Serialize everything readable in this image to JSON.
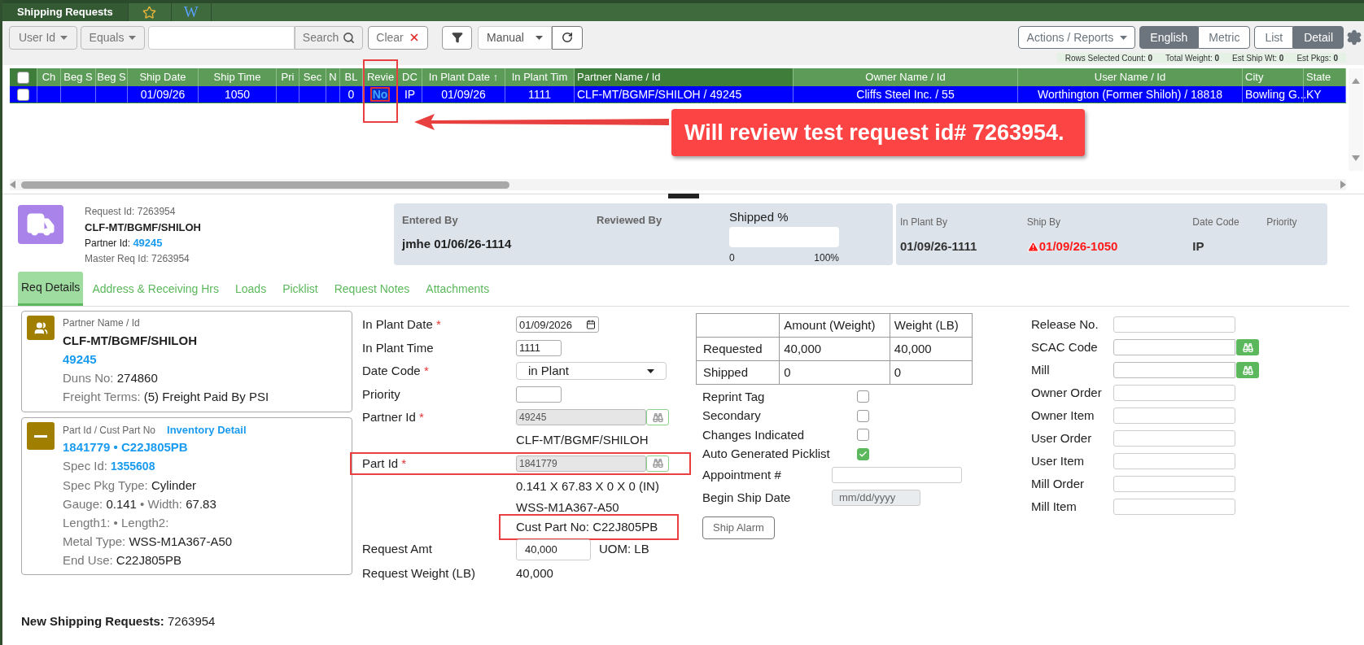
{
  "app_tabs": [
    {
      "kind": "text",
      "label": "Shipping Requests",
      "selected": true
    },
    {
      "kind": "star",
      "selected": false
    },
    {
      "kind": "serif",
      "label": "W",
      "selected": false
    }
  ],
  "toolbar": {
    "field_dropdown": "User Id",
    "operator_dropdown": "Equals",
    "search_button": "Search",
    "clear_button": "Clear",
    "mode_dropdown": "Manual",
    "actions_dropdown": "Actions / Reports",
    "units": [
      {
        "label": "English",
        "selected": true
      },
      {
        "label": "Metric",
        "selected": false
      }
    ],
    "views": [
      {
        "label": "List",
        "selected": false
      },
      {
        "label": "Detail",
        "selected": true
      }
    ]
  },
  "stats": [
    {
      "label": "Rows Selected Count:",
      "value": "0"
    },
    {
      "label": "Total Weight:",
      "value": "0"
    },
    {
      "label": "Est Ship Wt:",
      "value": "0"
    },
    {
      "label": "Est Pkgs:",
      "value": "0"
    }
  ],
  "grid": {
    "header_checked": false,
    "columns": [
      {
        "label": "Ch",
        "highlight": false
      },
      {
        "label": "Beg S",
        "highlight": false
      },
      {
        "label": "Beg S",
        "highlight": false
      },
      {
        "label": "Ship Date",
        "highlight": false
      },
      {
        "label": "Ship Time",
        "highlight": false
      },
      {
        "label": "Pri",
        "highlight": false
      },
      {
        "label": "Sec",
        "highlight": false
      },
      {
        "label": "N",
        "highlight": false
      },
      {
        "label": "BL",
        "highlight": false
      },
      {
        "label": "Revie",
        "highlight": true
      },
      {
        "label": "DC",
        "highlight": false
      },
      {
        "label": "In Plant Date ↑",
        "highlight": false
      },
      {
        "label": "In Plant Tim",
        "highlight": false
      },
      {
        "label": "Partner Name / Id",
        "highlight": false
      },
      {
        "label": "Owner Name / Id",
        "highlight": false
      },
      {
        "label": "User Name / Id",
        "highlight": false
      },
      {
        "label": "City",
        "highlight": false
      },
      {
        "label": "State",
        "highlight": false
      }
    ],
    "rows": [
      {
        "selected": true,
        "checked": false,
        "cells": [
          null,
          null,
          null,
          "01/09/26",
          "1050",
          null,
          null,
          null,
          "0",
          "No",
          "IP",
          "01/09/26",
          "1111",
          "CLF-MT/BGMF/SHILOH / 49245",
          "Cliffs Steel Inc. / 55",
          "Worthington (Former Shiloh) / 18818",
          "Bowling G...",
          "KY"
        ]
      }
    ]
  },
  "callout": "Will review test request id# 7263954.",
  "request": {
    "id_label": "Request Id:",
    "id": "7263954",
    "name": "CLF-MT/BGMF/SHILOH",
    "partner_label": "Partner Id:",
    "partner_id": "49245",
    "master_label": "Master Req Id:",
    "master_id": "7263954"
  },
  "summary": {
    "entered_label": "Entered By",
    "entered_value": "jmhe 01/06/26-1114",
    "reviewed_label": "Reviewed By",
    "shipped": {
      "label": "Shipped %",
      "level": 0,
      "min": "0",
      "max": "100%"
    }
  },
  "schedule": [
    {
      "kind": "normal",
      "label": "In Plant By",
      "value": "01/09/26-1111"
    },
    {
      "kind": "warning",
      "label": "Ship By",
      "value": "01/09/26-1050"
    },
    {
      "kind": "normal",
      "label": "Date Code",
      "value": "IP"
    },
    {
      "kind": "normal",
      "label": "Priority"
    }
  ],
  "detail_tabs": [
    {
      "label": "Req Details",
      "selected": true
    },
    {
      "label": "Address & Receiving Hrs",
      "selected": false
    },
    {
      "label": "Loads",
      "selected": false
    },
    {
      "label": "Picklist",
      "selected": false
    },
    {
      "label": "Request Notes",
      "selected": false
    },
    {
      "label": "Attachments",
      "selected": false
    }
  ],
  "partner_card": {
    "title": "Partner Name / Id",
    "name": "CLF-MT/BGMF/SHILOH",
    "id": "49245",
    "lines": [
      {
        "parts": [
          {
            "label": "Duns No:",
            "value": "274860"
          }
        ]
      },
      {
        "parts": [
          {
            "label": "Freight Terms:",
            "value": "(5) Freight Paid By PSI"
          }
        ]
      }
    ]
  },
  "part_card": {
    "title": "Part Id / Cust Part No",
    "link": "Inventory Detail",
    "heading": "1841779 • C22J805PB",
    "lines": [
      {
        "parts": [
          {
            "label": "Spec Id:",
            "link": "1355608"
          }
        ]
      },
      {
        "parts": [
          {
            "label": "Spec Pkg Type:",
            "value": "Cylinder"
          }
        ]
      },
      {
        "separator": "•",
        "parts": [
          {
            "label": "Gauge:",
            "value": "0.141"
          },
          {
            "label": "Width:",
            "value": "67.83"
          }
        ]
      },
      {
        "separator": "•",
        "parts": [
          {
            "label": "Length1:"
          },
          {
            "label": "Length2:"
          }
        ]
      },
      {
        "parts": [
          {
            "label": "Metal Type:",
            "value": "WSS-M1A367-A50"
          }
        ]
      },
      {
        "parts": [
          {
            "label": "End Use:",
            "value": "C22J805PB"
          }
        ]
      }
    ]
  },
  "form": [
    {
      "kind": "date",
      "label": "In Plant Date",
      "mark": "*",
      "value": "01/09/2026",
      "highlight": false
    },
    {
      "kind": "input",
      "label": "In Plant Time",
      "value": "1111",
      "highlight": false
    },
    {
      "kind": "select",
      "label": "Date Code",
      "mark": "*",
      "value": "in Plant",
      "highlight": false
    },
    {
      "kind": "input",
      "label": "Priority",
      "highlight": false
    },
    {
      "kind": "lookup",
      "label": "Partner Id",
      "mark": "*",
      "value": "49245",
      "highlight": false
    },
    {
      "kind": "note",
      "value": "CLF-MT/BGMF/SHILOH",
      "highlight": false
    },
    {
      "kind": "lookup",
      "label": "Part Id",
      "mark": "*",
      "value": "1841779",
      "highlight": true
    },
    {
      "kind": "note",
      "value": "0.141 X 67.83 X 0 X 0 (IN)",
      "highlight": false
    },
    {
      "kind": "note",
      "value": "WSS-M1A367-A50",
      "highlight": false
    },
    {
      "kind": "note",
      "value": "Cust Part No: C22J805PB",
      "highlight": true
    },
    {
      "kind": "amount",
      "label": "Request Amt",
      "value": "40,000",
      "unit": "UOM: LB",
      "highlight": false
    },
    {
      "kind": "value",
      "label": "Request Weight (LB)",
      "value": "40,000",
      "highlight": false
    }
  ],
  "amounts": {
    "columns": [
      "Amount (Weight)",
      "Weight (LB)"
    ],
    "rows": [
      {
        "label": "Requested",
        "values": [
          "40,000",
          "40,000"
        ]
      },
      {
        "label": "Shipped",
        "values": [
          "0",
          "0"
        ]
      }
    ]
  },
  "flags": [
    {
      "label": "Reprint Tag",
      "checked": false
    },
    {
      "label": "Secondary",
      "checked": false
    },
    {
      "label": "Changes Indicated",
      "checked": false
    },
    {
      "label": "Auto Generated Picklist",
      "checked": true
    }
  ],
  "extra_fields": [
    {
      "kind": "input",
      "label": "Appointment #",
      "disabled": false
    },
    {
      "kind": "date",
      "label": "Begin Ship Date",
      "placeholder": "mm/dd/yyyy",
      "disabled": true
    }
  ],
  "ship_alarm_button": "Ship Alarm",
  "right_fields": [
    {
      "label": "Release No.",
      "lookup": false
    },
    {
      "label": "SCAC Code",
      "lookup": true
    },
    {
      "label": "Mill",
      "lookup": true
    },
    {
      "label": "Owner Order",
      "lookup": false
    },
    {
      "label": "Owner Item",
      "lookup": false
    },
    {
      "label": "User Order",
      "lookup": false
    },
    {
      "label": "User Item",
      "lookup": false
    },
    {
      "label": "Mill Order",
      "lookup": false
    },
    {
      "label": "Mill Item",
      "lookup": false
    }
  ],
  "footer": {
    "label": "New Shipping Requests:",
    "value": "7263954"
  }
}
